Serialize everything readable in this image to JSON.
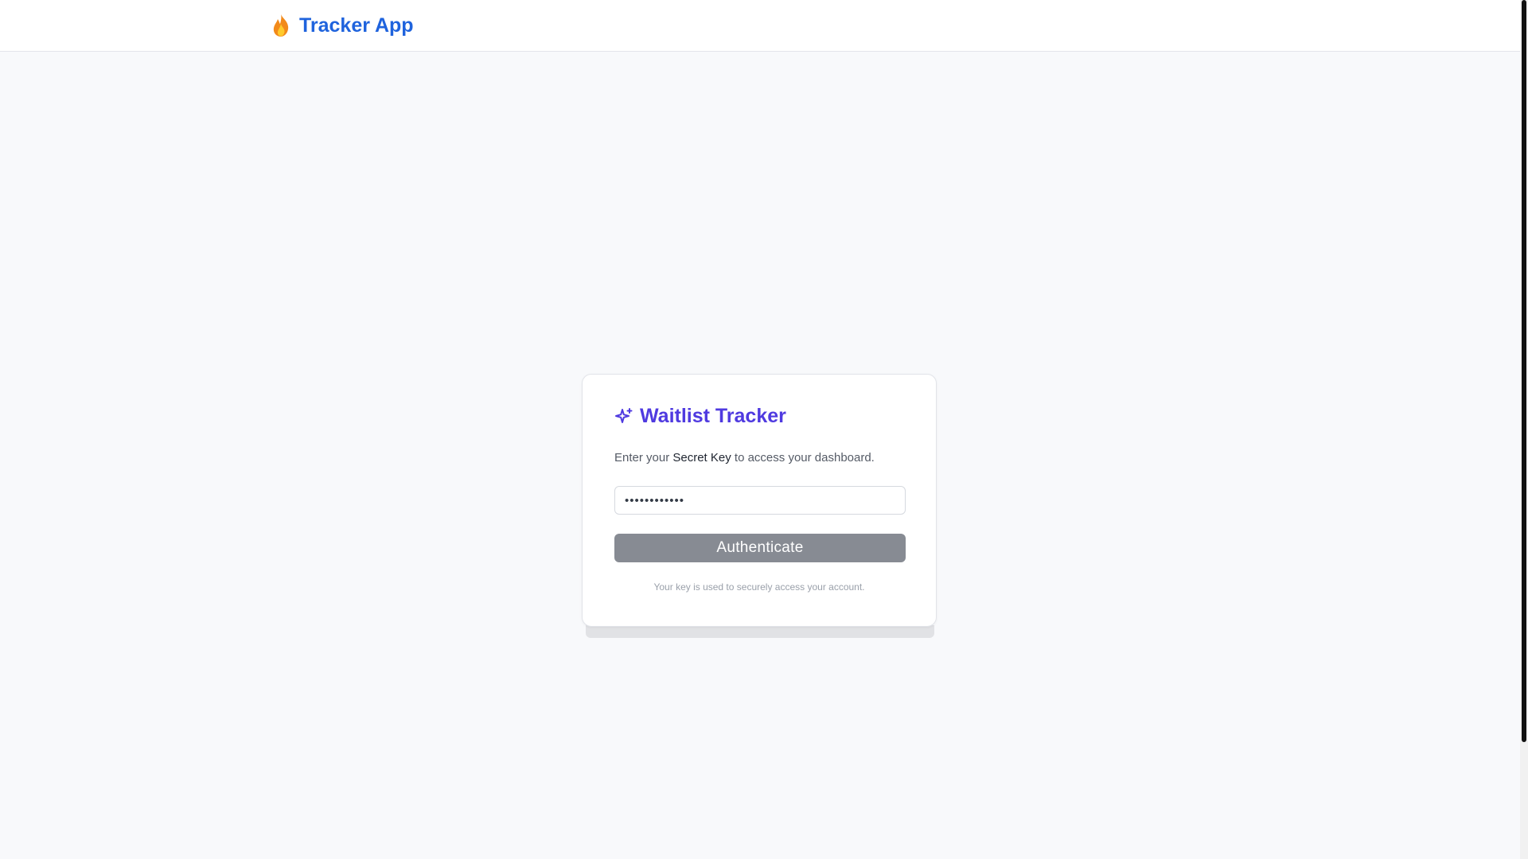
{
  "header": {
    "brand_icon": "fire-icon",
    "brand_name": "Tracker App",
    "brand_color": "#1f63dd"
  },
  "login_card": {
    "title_icon": "sparkle-icon",
    "title": "Waitlist Tracker",
    "title_color": "#4f3ae0",
    "description_prefix": "Enter your ",
    "description_emphasis": "Secret Key",
    "description_suffix": " to access your dashboard.",
    "secret_key_value": "••••••••••••",
    "button_label": "Authenticate",
    "button_color": "#878b93",
    "footnote": "Your key is used to securely access your account."
  }
}
